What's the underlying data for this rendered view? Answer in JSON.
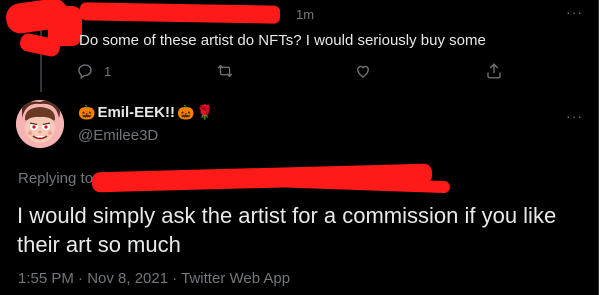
{
  "parent": {
    "time": "1m",
    "text": "Do some of these artist do NFTs? I would seriously buy some",
    "reply_count": "1",
    "menu": "···"
  },
  "focused": {
    "display_name": "Emil-EEK!!",
    "name_emoji_left": "🎃",
    "name_emoji_right": "🎃",
    "name_emoji_rose": "🌹",
    "handle": "@Emilee3D",
    "menu": "···",
    "replying_to_label": "Replying to",
    "text": "I would simply ask the artist for a commission if you like their art so much",
    "timestamp": "1:55 PM · Nov 8, 2021 · Twitter Web App"
  },
  "icons": [
    "reply-icon",
    "retweet-icon",
    "like-icon",
    "share-icon",
    "more-icon"
  ],
  "colors": {
    "background": "#000000",
    "text": "#e7e9ea",
    "muted": "#71767b",
    "redaction": "#ff1a1a"
  }
}
